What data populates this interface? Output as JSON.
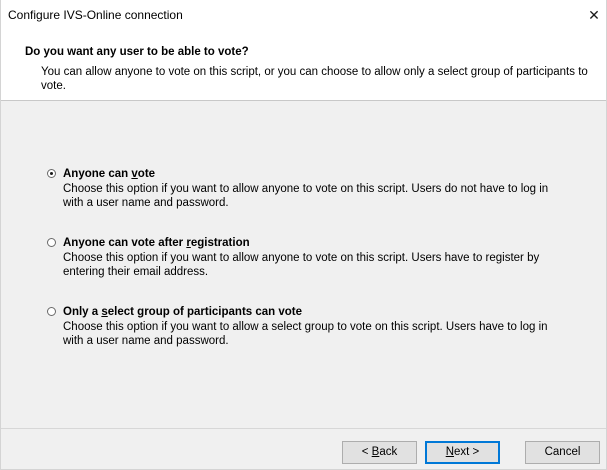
{
  "window": {
    "title": "Configure IVS-Online connection",
    "close_glyph": "✕"
  },
  "header": {
    "title": "Do you want any user to be able to vote?",
    "description": "You can allow anyone to vote on this script, or you can choose to allow only a select group of participants to vote."
  },
  "options": [
    {
      "label_pre": "Anyone can ",
      "label_accel": "v",
      "label_post": "ote",
      "description": "Choose this option if you want to allow anyone to vote on this script. Users do not have to log in with a user name and password.",
      "selected": true
    },
    {
      "label_pre": "Anyone can vote after ",
      "label_accel": "r",
      "label_post": "egistration",
      "description": "Choose this option if you want to allow anyone to vote on this script. Users have to register by entering their email address.",
      "selected": false
    },
    {
      "label_pre": "Only a ",
      "label_accel": "s",
      "label_post": "elect group of participants can vote",
      "description": "Choose this option if you want to allow a select group to vote on this script. Users have to log in with a user name and password.",
      "selected": false
    }
  ],
  "buttons": {
    "back_pre": "< ",
    "back_accel": "B",
    "back_post": "ack",
    "next_accel": "N",
    "next_post": "ext >",
    "cancel": "Cancel"
  },
  "colors": {
    "focus_border": "#0078d7",
    "body_bg": "#f0f0f0",
    "header_bg": "#ffffff"
  }
}
